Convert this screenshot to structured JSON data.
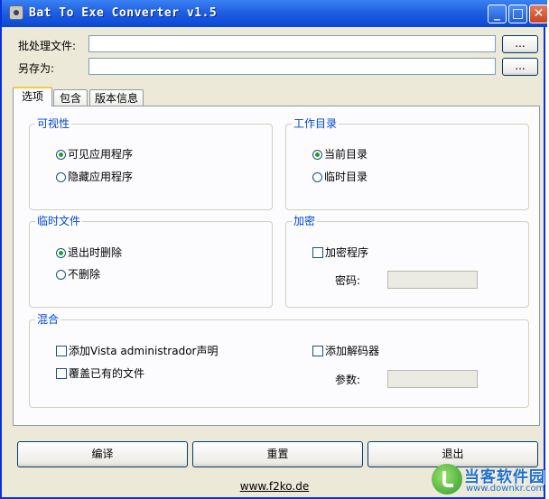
{
  "window": {
    "title": "Bat To Exe Converter v1.5",
    "minimize_glyph": "_",
    "maximize_glyph": "□",
    "close_glyph": "✕"
  },
  "files": {
    "batch_label": "批处理文件:",
    "batch_value": "",
    "saveas_label": "另存为:",
    "saveas_value": "",
    "browse_label": "..."
  },
  "tabs": [
    {
      "label": "选项",
      "active": true
    },
    {
      "label": "包含",
      "active": false
    },
    {
      "label": "版本信息",
      "active": false
    }
  ],
  "visibility": {
    "title": "可视性",
    "options": [
      {
        "label": "可见应用程序",
        "selected": true
      },
      {
        "label": "隐藏应用程序",
        "selected": false
      }
    ]
  },
  "workdir": {
    "title": "工作目录",
    "options": [
      {
        "label": "当前目录",
        "selected": true
      },
      {
        "label": "临时目录",
        "selected": false
      }
    ]
  },
  "tempfiles": {
    "title": "临时文件",
    "options": [
      {
        "label": "退出时删除",
        "selected": true
      },
      {
        "label": "不删除",
        "selected": false
      }
    ]
  },
  "encrypt": {
    "title": "加密",
    "checkbox_label": "加密程序",
    "checked": false,
    "password_label": "密码:",
    "password_value": ""
  },
  "misc": {
    "title": "混合",
    "add_vista_label": "添加Vista administrador声明",
    "overwrite_label": "覆盖已有的文件",
    "add_decoder_label": "添加解码器",
    "params_label": "参数:",
    "params_value": ""
  },
  "buttons": {
    "compile": "编译",
    "reset": "重置",
    "exit": "退出"
  },
  "footer": {
    "link": "www.f2ko.de"
  },
  "watermark": {
    "name": "当客软件园",
    "url": "www.downkr.com"
  }
}
